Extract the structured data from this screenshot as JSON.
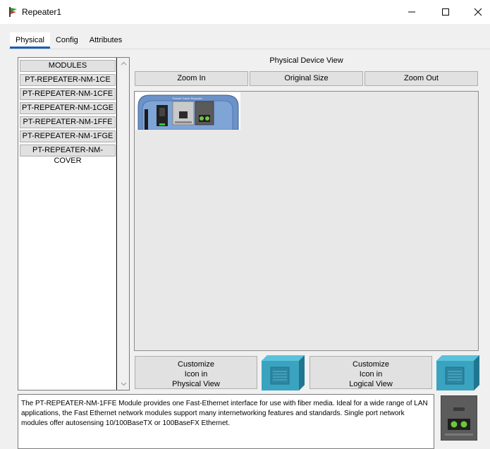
{
  "window": {
    "title": "Repeater1"
  },
  "tabs": [
    {
      "label": "Physical",
      "active": true
    },
    {
      "label": "Config",
      "active": false
    },
    {
      "label": "Attributes",
      "active": false
    }
  ],
  "modules": {
    "header": "MODULES",
    "items": [
      "PT-REPEATER-NM-1CE",
      "PT-REPEATER-NM-1CFE",
      "PT-REPEATER-NM-1CGE",
      "PT-REPEATER-NM-1FFE",
      "PT-REPEATER-NM-1FGE",
      "PT-REPEATER-NM-COVER"
    ]
  },
  "physical_view": {
    "title": "Physical Device View",
    "zoom_in": "Zoom In",
    "original_size": "Original Size",
    "zoom_out": "Zoom Out",
    "device_label": "Packet Tracer Repeater"
  },
  "customize": {
    "physical": {
      "line1": "Customize",
      "line2": "Icon in",
      "line3": "Physical View"
    },
    "logical": {
      "line1": "Customize",
      "line2": "Icon in",
      "line3": "Logical View"
    }
  },
  "description": "The PT-REPEATER-NM-1FFE Module provides one Fast-Ethernet interface for use with fiber media. Ideal for a wide range of LAN applications, the Fast Ethernet network modules support many internetworking features and standards. Single port network modules offer autosensing 10/100BaseTX or 100BaseFX Ethernet.",
  "colors": {
    "tab_accent": "#1a5fb4",
    "device_blue": "#6b93c9",
    "icon_teal": "#3aa3c0"
  }
}
